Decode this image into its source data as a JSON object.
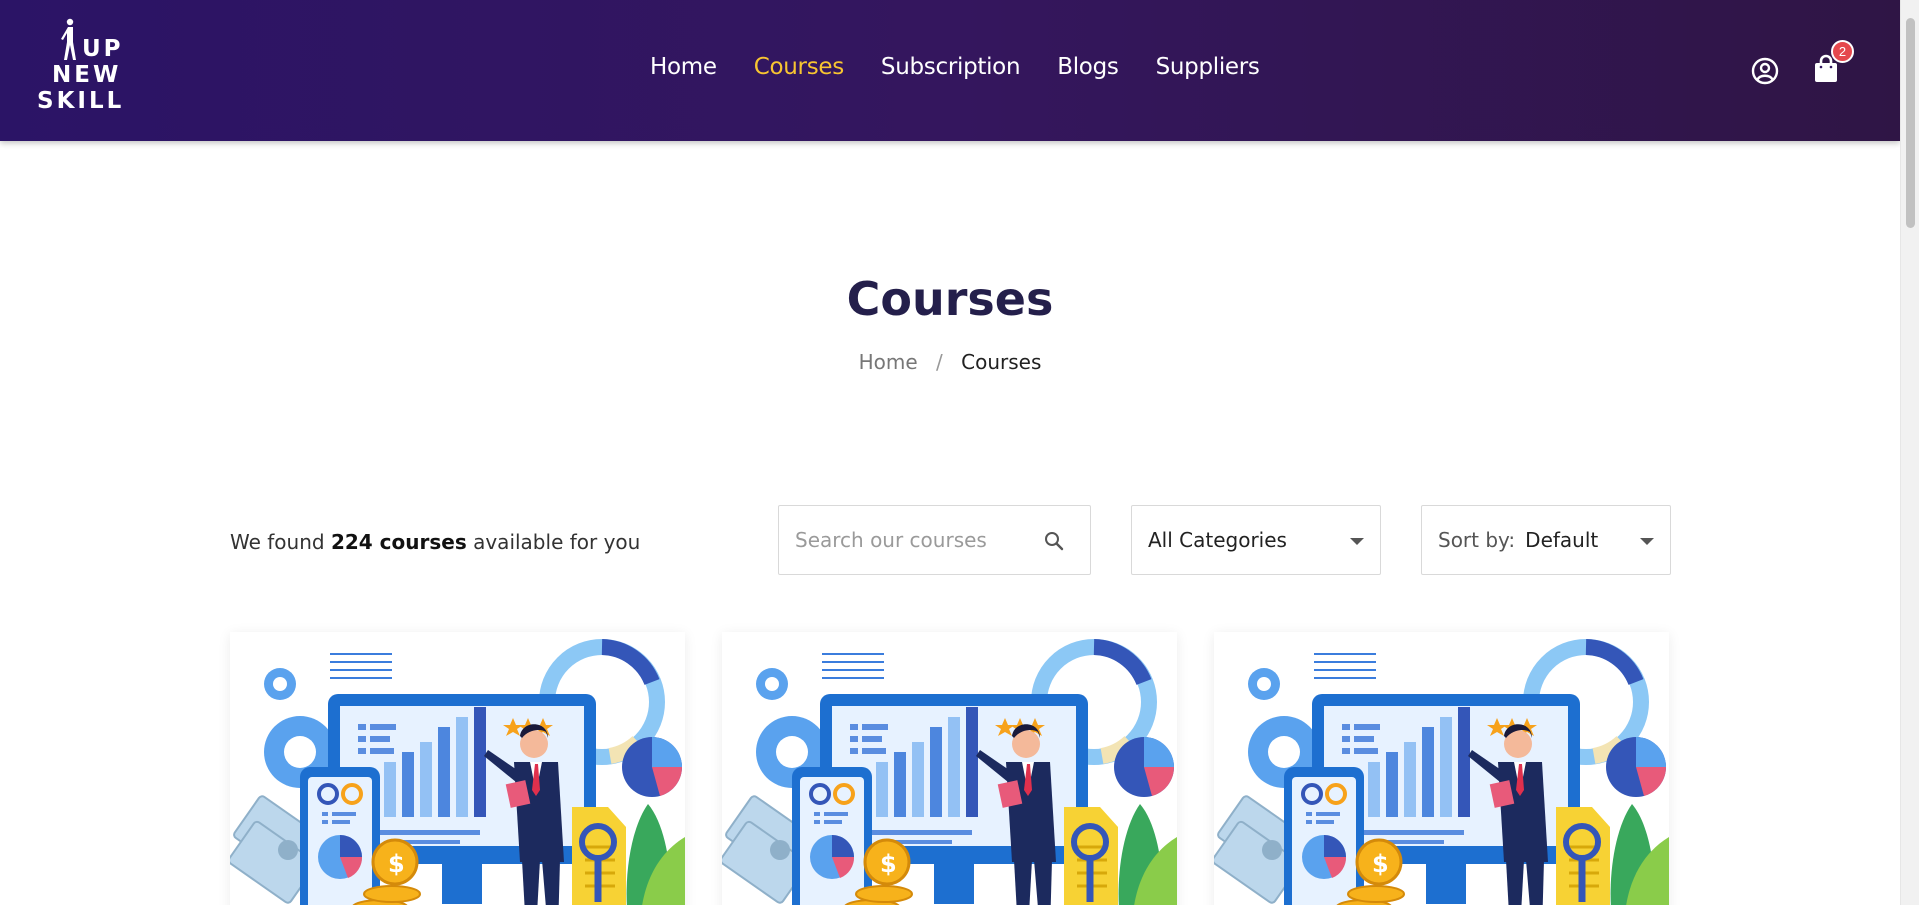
{
  "header": {
    "logo_lines": [
      "UP",
      "NEW",
      "SKILL"
    ],
    "nav": [
      {
        "label": "Home",
        "active": false
      },
      {
        "label": "Courses",
        "active": true
      },
      {
        "label": "Subscription",
        "active": false
      },
      {
        "label": "Blogs",
        "active": false
      },
      {
        "label": "Suppliers",
        "active": false
      }
    ],
    "user_icon": "user-circle-icon",
    "cart_icon": "shopping-bag-icon",
    "cart_count": "2"
  },
  "hero": {
    "title": "Courses",
    "breadcrumb": {
      "home": "Home",
      "separator": "/",
      "current": "Courses"
    }
  },
  "filters": {
    "found_prefix": "We found",
    "found_count": "224 courses",
    "found_suffix": "available for you",
    "search_placeholder": "Search our courses",
    "category_value": "All Categories",
    "sort_prefix": "Sort by:",
    "sort_value": "Default"
  },
  "courses": [
    {
      "thumbnail": "business-analytics-illustration"
    },
    {
      "thumbnail": "business-analytics-illustration"
    },
    {
      "thumbnail": "business-analytics-illustration"
    }
  ],
  "colors": {
    "header_start": "#2b1466",
    "header_end": "#2f1545",
    "nav_active": "#f8c531",
    "title": "#241f4b",
    "badge": "#e5484d"
  }
}
